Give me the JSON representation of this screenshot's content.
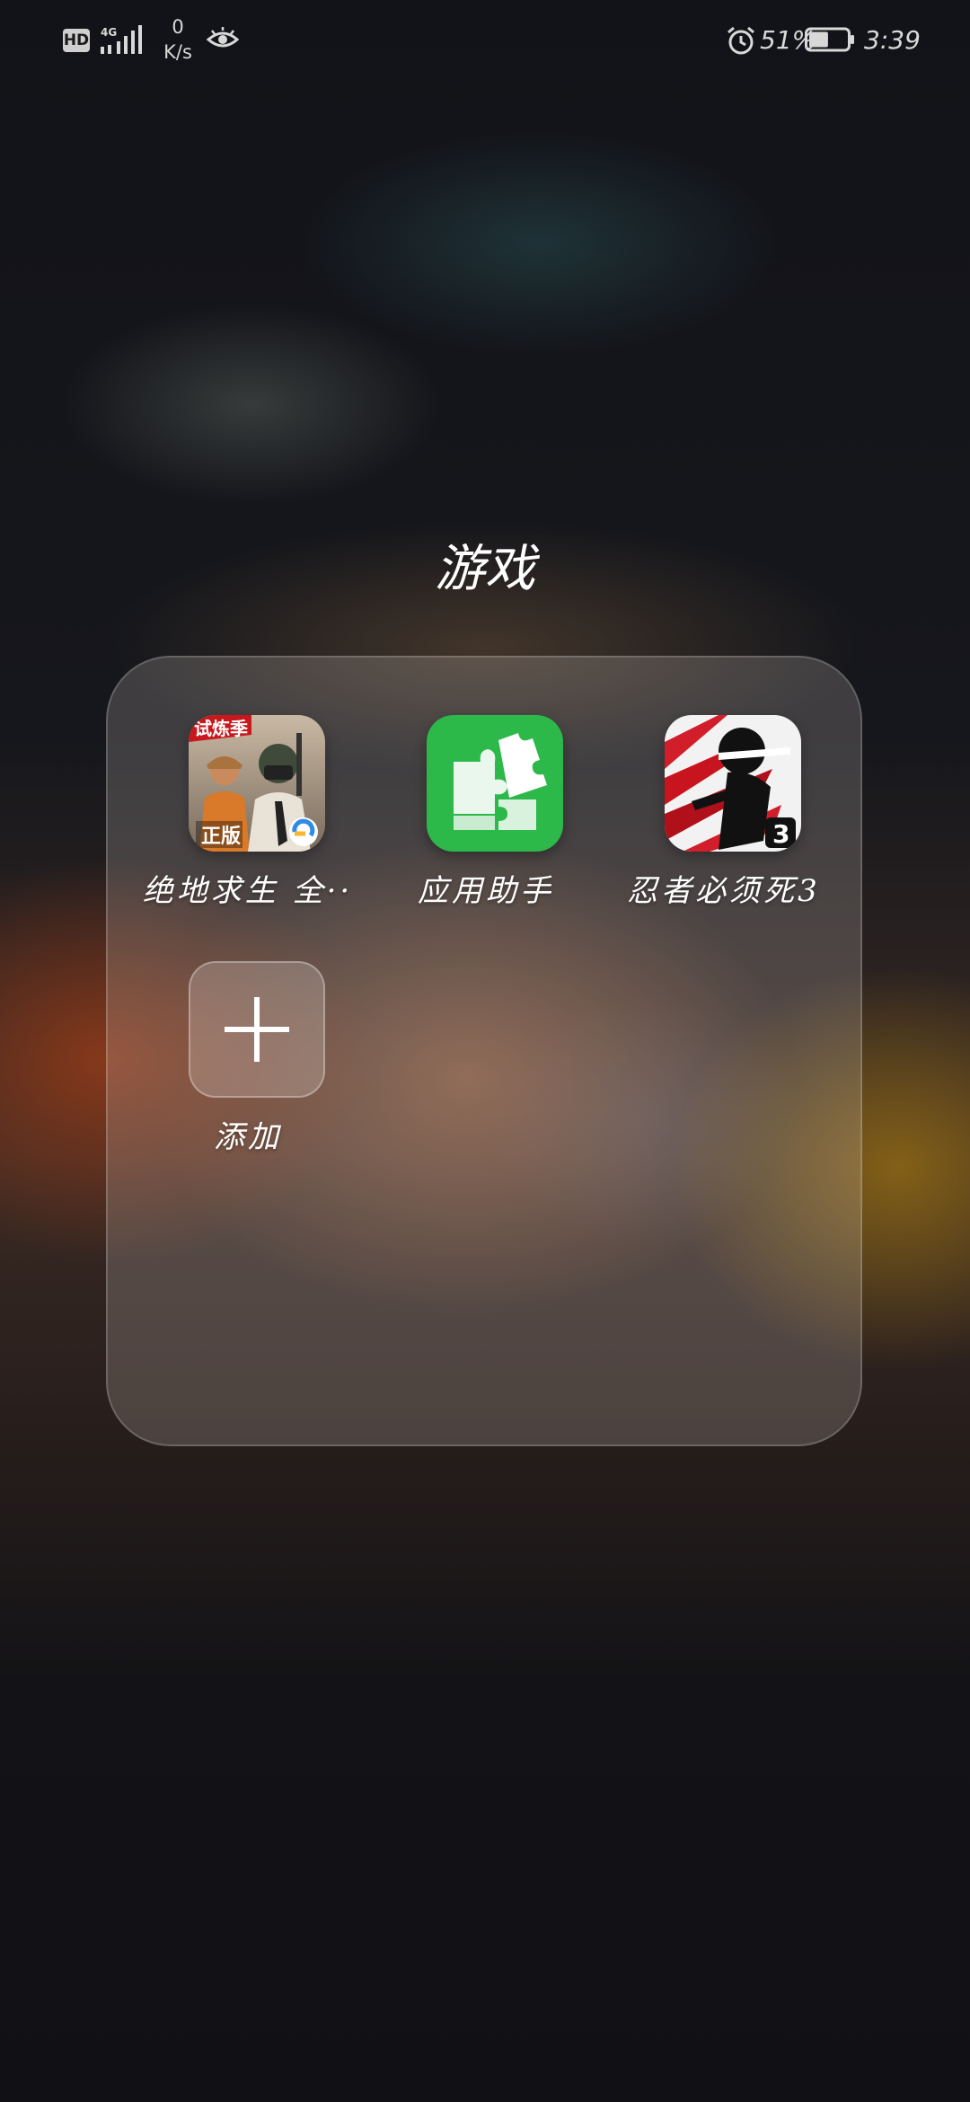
{
  "status_bar": {
    "hd_badge": "HD",
    "network": "4G",
    "speed_value": "0",
    "speed_unit": "K/s",
    "battery_percent": "51%",
    "time": "3:39",
    "battery_level": 0.51
  },
  "folder": {
    "title": "游戏",
    "apps": [
      {
        "label": "绝地求生 全··",
        "icon": "pubg-game-icon",
        "icon_badge_top": "试炼季",
        "icon_badge_bottom": "正版"
      },
      {
        "label": "应用助手",
        "icon": "puzzle-icon",
        "color": "#2db84a"
      },
      {
        "label": "忍者必须死3",
        "icon": "ninja-game-icon",
        "icon_badge": "3"
      }
    ],
    "add_label": "添加"
  }
}
